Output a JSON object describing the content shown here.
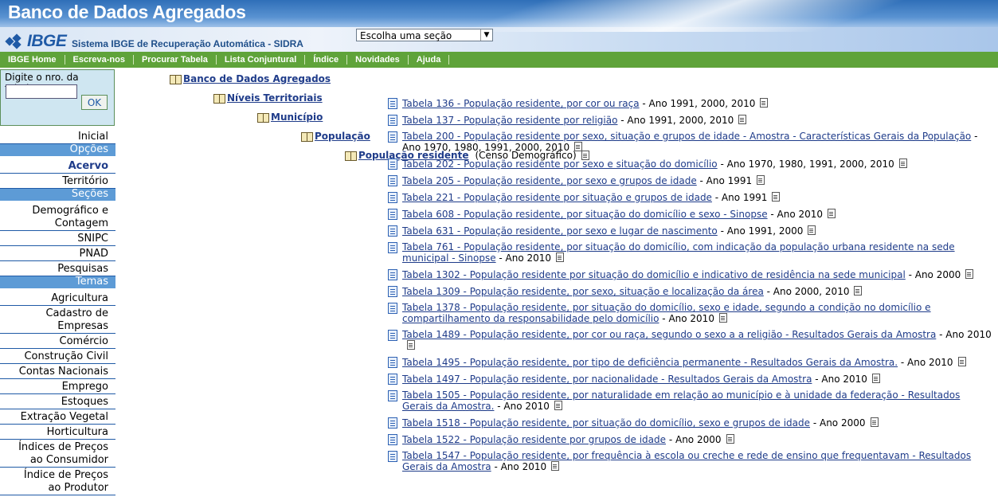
{
  "header": {
    "app_title": "Banco de Dados Agregados",
    "logo_text": "IBGE",
    "system_name": "Sistema IBGE de Recuperação Automática - SIDRA",
    "section_select": "Escolha uma seção"
  },
  "nav": [
    "IBGE Home",
    "Escreva-nos",
    "Procurar Tabela",
    "Lista Conjuntural",
    "Índice",
    "Novidades",
    "Ajuda"
  ],
  "sidebar": {
    "table_label": "Digite o nro. da tabela:",
    "ok": "OK",
    "items": [
      {
        "type": "link",
        "label": "Inicial"
      },
      {
        "type": "head",
        "label": "Opções"
      },
      {
        "type": "link",
        "label": "Acervo",
        "bold": true
      },
      {
        "type": "link",
        "label": "Território"
      },
      {
        "type": "head",
        "label": "Seções"
      },
      {
        "type": "link",
        "label": "Demográfico e Contagem",
        "lines": [
          "Demográfico e",
          "Contagem"
        ]
      },
      {
        "type": "link",
        "label": "SNIPC"
      },
      {
        "type": "link",
        "label": "PNAD"
      },
      {
        "type": "link",
        "label": "Pesquisas"
      },
      {
        "type": "head",
        "label": "Temas"
      },
      {
        "type": "link",
        "label": "Agricultura"
      },
      {
        "type": "link",
        "label": "Cadastro de Empresas",
        "lines": [
          "Cadastro de",
          "Empresas"
        ]
      },
      {
        "type": "link",
        "label": "Comércio"
      },
      {
        "type": "link",
        "label": "Construção Civil"
      },
      {
        "type": "link",
        "label": "Contas Nacionais"
      },
      {
        "type": "link",
        "label": "Emprego"
      },
      {
        "type": "link",
        "label": "Estoques"
      },
      {
        "type": "link",
        "label": "Extração Vegetal"
      },
      {
        "type": "link",
        "label": "Horticultura"
      },
      {
        "type": "link",
        "label": "Índices de Preços ao Consumidor",
        "lines": [
          "Índices de Preços",
          "ao Consumidor"
        ]
      },
      {
        "type": "link",
        "label": "Índice de Preços ao Produtor",
        "lines": [
          "Índice de Preços",
          "ao Produtor"
        ]
      }
    ]
  },
  "breadcrumb": {
    "level1": "Banco de Dados Agregados",
    "level2": "Níveis Territoriais",
    "level3": "Município",
    "level4": "População",
    "level5": "População residente",
    "level5_note": "(Censo Demográfico)"
  },
  "tables": [
    {
      "link": "Tabela 136 - População residente, por cor ou raça",
      "years": " - Ano 1991, 2000, 2010"
    },
    {
      "link": "Tabela 137 - População residente por religião",
      "years": " - Ano 1991, 2000, 2010"
    },
    {
      "link": "Tabela 200 - População residente por sexo, situação e grupos de idade - Amostra - Características Gerais da População",
      "years": " - Ano 1970, 1980, 1991, 2000, 2010"
    },
    {
      "link": "Tabela 202 - População residente por sexo e situação do domicílio",
      "years": " - Ano 1970, 1980, 1991, 2000, 2010"
    },
    {
      "link": "Tabela 205 - População residente, por sexo e grupos de idade",
      "years": " - Ano 1991"
    },
    {
      "link": "Tabela 221 - População residente por situação e grupos de idade",
      "years": " - Ano 1991"
    },
    {
      "link": "Tabela 608 - População residente, por situação do domicílio e sexo - Sinopse",
      "years": " - Ano 2010"
    },
    {
      "link": "Tabela 631 - População residente, por sexo e lugar de nascimento",
      "years": " - Ano 1991, 2000"
    },
    {
      "link": "Tabela 761 - População residente, por situação do domicílio, com indicação da população urbana residente na sede municipal - Sinopse",
      "years": " - Ano 2010"
    },
    {
      "link": "Tabela 1302 - População residente por situação do domicílio e indicativo de residência na sede municipal",
      "years": " - Ano 2000"
    },
    {
      "link": "Tabela 1309 - População residente, por sexo, situação e localização da área",
      "years": " - Ano 2000, 2010"
    },
    {
      "link": "Tabela 1378 - População residente, por situação do domicílio, sexo e idade, segundo a condição no domicílio e compartilhamento da responsabilidade pelo domicílio",
      "years": " - Ano 2010"
    },
    {
      "link": "Tabela 1489 - População residente, por cor ou raça, segundo o sexo a a religião - Resultados Gerais da Amostra",
      "years": " - Ano 2010"
    },
    {
      "link": "Tabela 1495 - População residente, por tipo de deficiência permanente - Resultados Gerais da Amostra.",
      "years": " - Ano 2010"
    },
    {
      "link": "Tabela 1497 - População residente, por nacionalidade - Resultados Gerais da Amostra",
      "years": " - Ano 2010"
    },
    {
      "link": "Tabela 1505 - População residente, por naturalidade em relação ao município e à unidade da federação - Resultados Gerais da Amostra.",
      "years": " - Ano 2010"
    },
    {
      "link": "Tabela 1518 - População residente, por situação do domicílio, sexo e grupos de idade",
      "years": " - Ano 2000"
    },
    {
      "link": "Tabela 1522 - População residente por grupos de idade",
      "years": " - Ano 2000"
    },
    {
      "link": "Tabela 1547 - População residente, por frequência à escola ou creche e rede de ensino que frequentavam - Resultados Gerais da Amostra",
      "years": " - Ano 2010"
    }
  ]
}
